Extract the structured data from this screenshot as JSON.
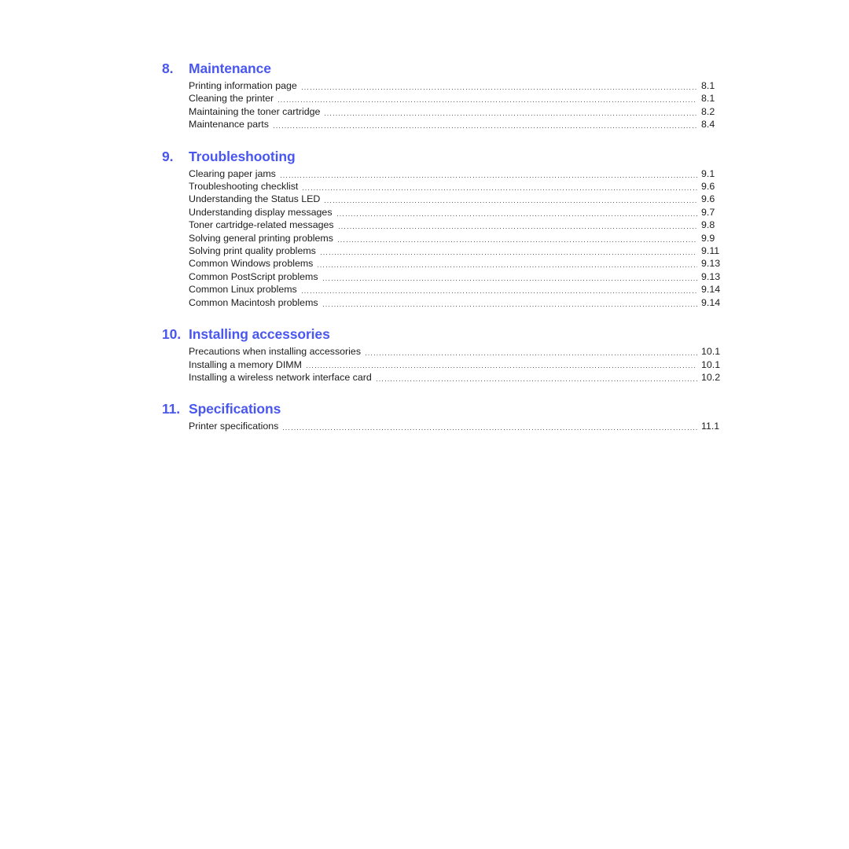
{
  "document": {
    "type": "table-of-contents",
    "background_color": "#ffffff",
    "heading_color": "#4a57ef",
    "text_color": "#1c1c1c",
    "leader_style": "dotted"
  },
  "sections": [
    {
      "number": "8.",
      "title": "Maintenance",
      "entries": [
        {
          "label": "Printing information page",
          "page": "8.1"
        },
        {
          "label": "Cleaning the printer",
          "page": "8.1"
        },
        {
          "label": "Maintaining the toner cartridge",
          "page": "8.2"
        },
        {
          "label": "Maintenance parts",
          "page": "8.4"
        }
      ]
    },
    {
      "number": "9.",
      "title": "Troubleshooting",
      "entries": [
        {
          "label": "Clearing paper jams",
          "page": "9.1"
        },
        {
          "label": "Troubleshooting checklist",
          "page": "9.6"
        },
        {
          "label": "Understanding the Status LED",
          "page": "9.6"
        },
        {
          "label": "Understanding display messages",
          "page": "9.7"
        },
        {
          "label": "Toner cartridge-related messages",
          "page": "9.8"
        },
        {
          "label": "Solving general printing problems",
          "page": "9.9"
        },
        {
          "label": "Solving print quality problems",
          "page": "9.11"
        },
        {
          "label": "Common Windows problems",
          "page": "9.13"
        },
        {
          "label": "Common PostScript problems",
          "page": "9.13"
        },
        {
          "label": "Common Linux problems",
          "page": "9.14"
        },
        {
          "label": "Common Macintosh problems",
          "page": "9.14"
        }
      ]
    },
    {
      "number": "10.",
      "title": "Installing accessories",
      "entries": [
        {
          "label": "Precautions when installing accessories",
          "page": "10.1"
        },
        {
          "label": "Installing a memory DIMM",
          "page": "10.1"
        },
        {
          "label": "Installing a wireless network interface card",
          "page": "10.2"
        }
      ]
    },
    {
      "number": "11.",
      "title": "Specifications",
      "entries": [
        {
          "label": "Printer specifications",
          "page": "11.1"
        }
      ]
    }
  ]
}
